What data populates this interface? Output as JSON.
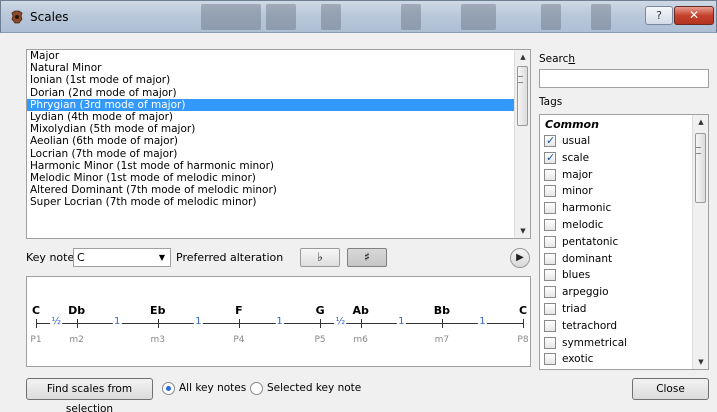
{
  "window": {
    "title": "Scales",
    "help_label": "?",
    "close_label": "✕"
  },
  "scales": [
    "Major",
    "Natural Minor",
    "Ionian (1st mode of major)",
    "Dorian (2nd mode of major)",
    "Phrygian (3rd mode of major)",
    "Lydian (4th mode of major)",
    "Mixolydian (5th mode of major)",
    "Aeolian (6th mode of major)",
    "Locrian (7th mode of major)",
    "Harmonic Minor (1st mode of harmonic minor)",
    "Melodic Minor (1st mode of melodic minor)",
    "Altered Dominant (7th mode of melodic minor)",
    "Super Locrian (7th mode of melodic minor)"
  ],
  "selected_scale_index": 4,
  "key_note": {
    "label": "Key note",
    "value": "C"
  },
  "alteration": {
    "label": "Preferred alteration",
    "flat": "♭",
    "sharp": "♯",
    "selected": "sharp"
  },
  "staff": {
    "notes": [
      "C",
      "Db",
      "Eb",
      "F",
      "G",
      "Ab",
      "Bb",
      "C"
    ],
    "degrees": [
      "P1",
      "m2",
      "m3",
      "P4",
      "P5",
      "m6",
      "m7",
      "P8"
    ],
    "steps": [
      "½",
      "1",
      "1",
      "1",
      "½",
      "1",
      "1"
    ]
  },
  "find": {
    "button": "Find scales from selection",
    "all_keys": "All key notes",
    "selected_key": "Selected key note",
    "selected_option": "all"
  },
  "search": {
    "label_before": "Searc",
    "label_accel": "h",
    "value": ""
  },
  "tags": {
    "label": "Tags",
    "category": "Common",
    "items": [
      {
        "name": "usual",
        "checked": true
      },
      {
        "name": "scale",
        "checked": true
      },
      {
        "name": "major",
        "checked": false
      },
      {
        "name": "minor",
        "checked": false
      },
      {
        "name": "harmonic",
        "checked": false
      },
      {
        "name": "melodic",
        "checked": false
      },
      {
        "name": "pentatonic",
        "checked": false
      },
      {
        "name": "dominant",
        "checked": false
      },
      {
        "name": "blues",
        "checked": false
      },
      {
        "name": "arpeggio",
        "checked": false
      },
      {
        "name": "triad",
        "checked": false
      },
      {
        "name": "tetrachord",
        "checked": false
      },
      {
        "name": "symmetrical",
        "checked": false
      },
      {
        "name": "exotic",
        "checked": false
      }
    ]
  },
  "close_button": "Close",
  "colors": {
    "selection": "#3399ff",
    "step_text": "#3366cc",
    "close_red": "#c7412d"
  }
}
